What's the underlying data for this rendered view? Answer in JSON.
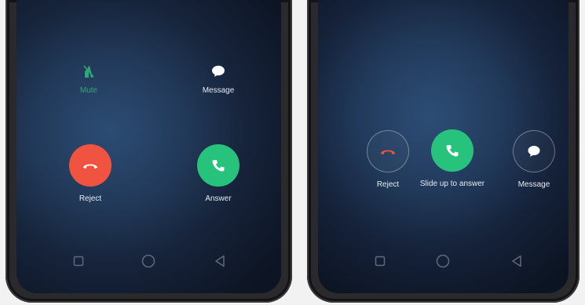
{
  "left_screen": {
    "mute_label": "Mute",
    "message_label": "Message",
    "reject_label": "Reject",
    "answer_label": "Answer"
  },
  "right_screen": {
    "reject_label": "Reject",
    "answer_label": "Slide up to answer",
    "message_label": "Message"
  },
  "nav": {
    "icons": [
      "recent-apps-icon",
      "home-icon",
      "back-icon"
    ]
  },
  "colors": {
    "reject": "#f0533f",
    "answer": "#27c37c",
    "active_label": "#2fa877",
    "screen_bg": "#1b2d48"
  }
}
